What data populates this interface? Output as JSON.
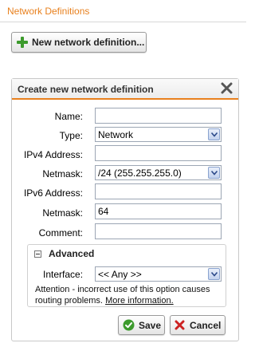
{
  "header": {
    "title": "Network Definitions"
  },
  "toolbar": {
    "new_label": "New network definition..."
  },
  "dialog": {
    "title": "Create new network definition",
    "fields": {
      "name": {
        "label": "Name:",
        "value": ""
      },
      "type": {
        "label": "Type:",
        "value": "Network"
      },
      "ipv4": {
        "label": "IPv4 Address:",
        "value": ""
      },
      "netmask4": {
        "label": "Netmask:",
        "value": "/24 (255.255.255.0)"
      },
      "ipv6": {
        "label": "IPv6 Address:",
        "value": ""
      },
      "netmask6": {
        "label": "Netmask:",
        "value": "64"
      },
      "comment": {
        "label": "Comment:",
        "value": ""
      }
    },
    "advanced": {
      "title": "Advanced",
      "interface_label": "Interface:",
      "interface_value": "<< Any >>",
      "attention_text": "Attention - incorrect use of this option causes routing problems.",
      "more_info": "More information."
    },
    "save_label": "Save",
    "cancel_label": "Cancel"
  },
  "colors": {
    "accent": "#e8801e",
    "save_green": "#3c9a2c",
    "cancel_red": "#cc2222"
  }
}
